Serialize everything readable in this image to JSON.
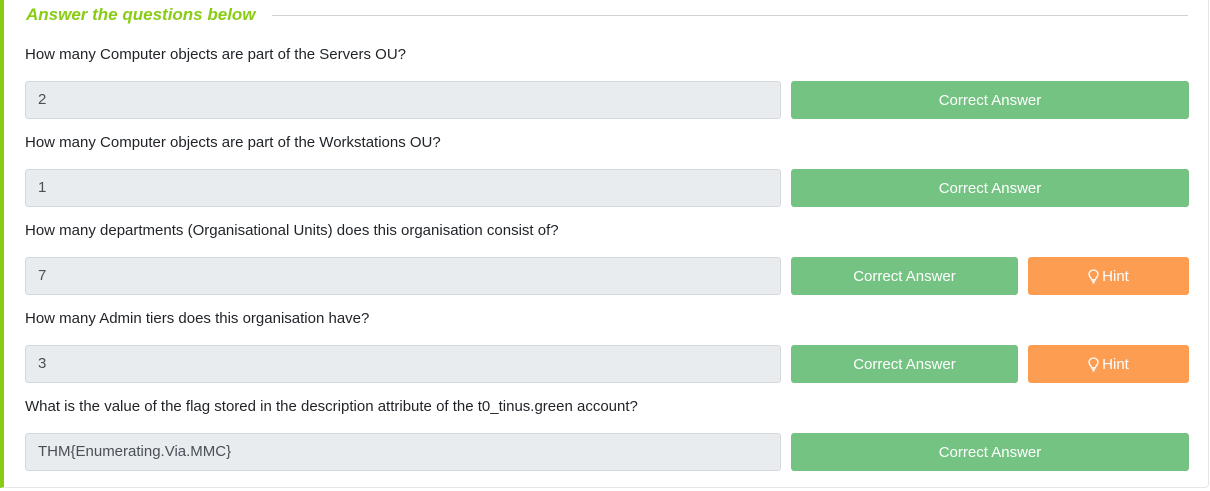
{
  "section": {
    "title": "Answer the questions below"
  },
  "questions": [
    {
      "text": "How many Computer objects are part of the Servers OU?",
      "answer": "2",
      "submit_label": "Correct Answer"
    },
    {
      "text": "How many Computer objects are part of the Workstations OU?",
      "answer": "1",
      "submit_label": "Correct Answer"
    },
    {
      "text": "How many departments (Organisational Units) does this organisation consist of?",
      "answer": "7",
      "submit_label": "Correct Answer",
      "hint_label": "Hint",
      "hint_icon": "lightbulb-icon"
    },
    {
      "text": "How many Admin tiers does this organisation have?",
      "answer": "3",
      "submit_label": "Correct Answer",
      "hint_label": "Hint",
      "hint_icon": "lightbulb-icon"
    },
    {
      "text": "What is the value of the flag stored in the description attribute of the t0_tinus.green account?",
      "answer": "THM{Enumerating.Via.MMC}",
      "submit_label": "Correct Answer"
    }
  ],
  "colors": {
    "accent": "#88cc14",
    "correct": "#74c382",
    "hint": "#fd9d52",
    "input_bg": "#e9ecef"
  }
}
